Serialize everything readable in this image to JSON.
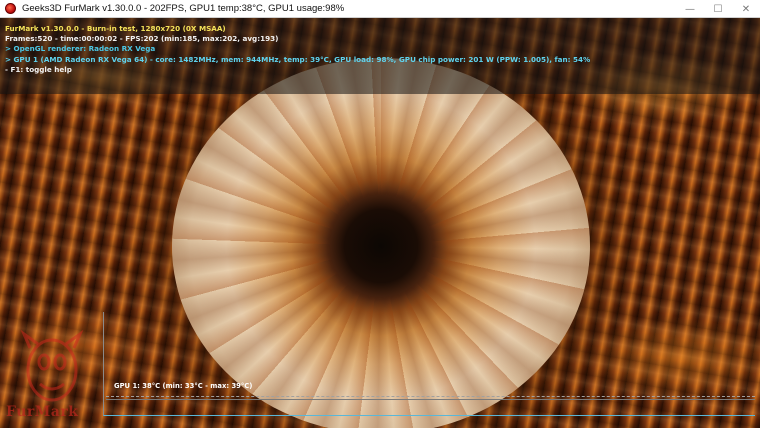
{
  "window": {
    "title": "Geeks3D FurMark v1.30.0.0 - 202FPS, GPU1 temp:38°C, GPU1 usage:98%",
    "controls": {
      "minimize": "—",
      "maximize": "☐",
      "close": "✕"
    }
  },
  "hud": {
    "lines": [
      "FurMark v1.30.0.0 - Burn-in test, 1280x720 (0X MSAA)",
      "Frames:520 - time:00:00:02 - FPS:202 (min:185, max:202, avg:193)",
      "> OpenGL renderer: Radeon RX Vega",
      "> GPU 1 (AMD Radeon RX Vega 64) - core: 1482MHz, mem: 944MHz, temp: 39°C, GPU load: 98%, GPU chip power: 201 W (PPW: 1.005), fan: 54%",
      "- F1: toggle help"
    ]
  },
  "graph": {
    "label": "GPU 1: 38°C (min: 33°C - max: 39°C)"
  },
  "logo": {
    "text": "FurMark"
  },
  "colors": {
    "hud_title": "#f4e25a",
    "hud_info": "#f2f2f2",
    "hud_gpu": "#4cc9e6",
    "graph_axis": "#5ab7d8"
  },
  "icons": {
    "app_icon": "furmark-app-icon"
  }
}
